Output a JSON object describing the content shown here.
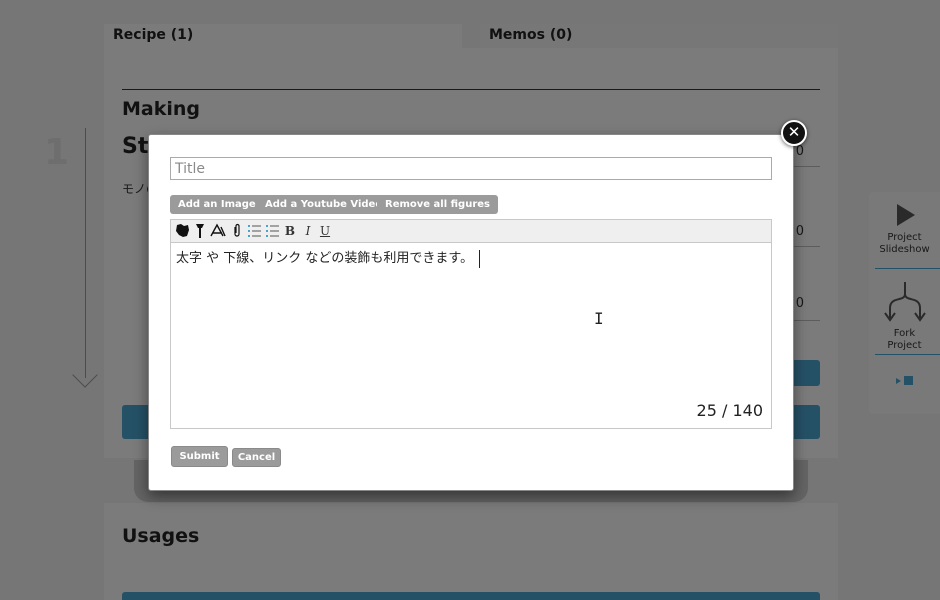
{
  "tabs": [
    {
      "label": "Recipe (1)"
    },
    {
      "label": "Memos (0)"
    }
  ],
  "recipe": {
    "section_title": "Making",
    "step_number": "1",
    "step_title": "St",
    "step_subtitle": "モノの",
    "values": [
      "0",
      "0",
      "0"
    ]
  },
  "usages": {
    "title": "Usages"
  },
  "side_panel": {
    "project_slideshow": "Project\nSlideshow",
    "fork_project": "Fork\nProject"
  },
  "modal": {
    "title_placeholder": "Title",
    "buttons": {
      "add_image": "Add an Image",
      "add_youtube": "Add a Youtube Video",
      "remove_figures": "Remove all figures"
    },
    "toolbar_icons": [
      "leaf-icon",
      "wrench-icon",
      "compass-icon",
      "paperclip-icon",
      "ordered-list-icon",
      "unordered-list-icon",
      "bold-icon",
      "italic-icon",
      "underline-icon"
    ],
    "editor_text": "太字 や 下線、リンク などの装飾も利用できます。",
    "char_counter": "25 / 140",
    "submit_label": "Submit",
    "cancel_label": "Cancel"
  },
  "colors": {
    "accent": "#4aa3cf",
    "button_gray": "#9b9b9b",
    "overlay": "rgba(0,0,0,0.5)"
  }
}
